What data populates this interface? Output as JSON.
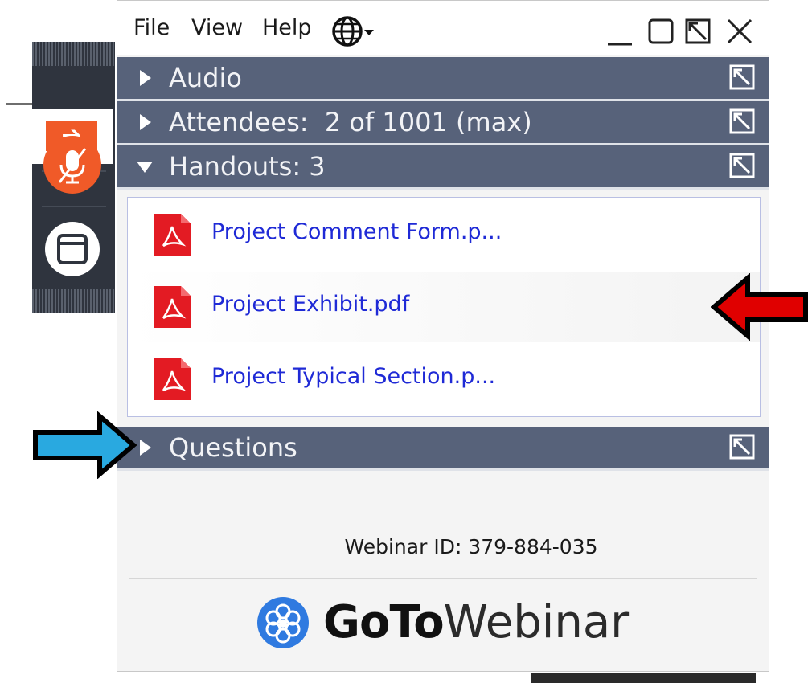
{
  "menubar": {
    "items": [
      "File",
      "View",
      "Help"
    ],
    "language_icon": "globe-dropdown-icon",
    "window_controls": [
      "minimize-icon",
      "maximize-icon",
      "popout-icon",
      "close-icon"
    ]
  },
  "grabtab": {
    "icons": [
      "exit-arrow-icon",
      "microphone-muted-icon",
      "window-view-icon"
    ],
    "exit_glyph": "➔"
  },
  "sections": [
    {
      "label": "Audio",
      "expanded": false
    },
    {
      "label": "Attendees:  2 of 1001 (max)",
      "expanded": false
    },
    {
      "label": "Handouts: 3",
      "expanded": true
    },
    {
      "label": "Questions",
      "expanded": false
    }
  ],
  "handouts": [
    {
      "name": "Project Comment Form.p..."
    },
    {
      "name": "Project Exhibit.pdf"
    },
    {
      "name": "Project Typical Section.p..."
    }
  ],
  "footer": {
    "webinar_id": "Webinar ID: 379-884-035",
    "brand_bold": "GoTo",
    "brand_light": "Webinar"
  },
  "annotations": {
    "red_arrow_color": "#e00000",
    "blue_arrow_color": "#29a9e0"
  },
  "colors": {
    "header_bg": "#57627a",
    "accent_orange": "#f05a28",
    "link_blue": "#1f2ad6",
    "pdf_red": "#e31b23"
  }
}
